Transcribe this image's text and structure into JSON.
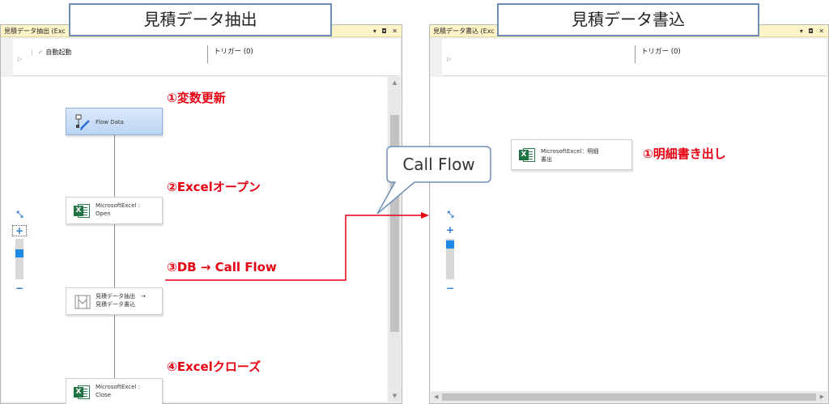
{
  "left_window": {
    "title": "見積データ抽出 (Exc",
    "controls": "▾ ◘ ✕",
    "autostart_label": "自動起動",
    "trigger_label": "トリガー (0)",
    "nodes": [
      {
        "label": "Flow Data"
      },
      {
        "label_line1": "MicrosoftExcel :",
        "label_line2": "Open"
      },
      {
        "label_line1": "見積データ抽出　→",
        "label_line2": "見積データ書込"
      },
      {
        "label_line1": "MicrosoftExcel :",
        "label_line2": "Close"
      }
    ]
  },
  "right_window": {
    "title": "見積データ書込 (Exc",
    "controls": "▾ ◘ ✕",
    "trigger_label": "トリガー (0)",
    "nodes": [
      {
        "label_line1": "MicrosoftExcel：明細",
        "label_line2": "書出"
      }
    ]
  },
  "overlay": {
    "title_left": "見積データ抽出",
    "title_right": "見積データ書込",
    "callout": "Call Flow",
    "annotations_left": [
      "①変数更新",
      "②Excelオープン",
      "③DB → Call Flow",
      "④Excelクローズ"
    ],
    "annotations_right": [
      "①明細書き出し"
    ]
  },
  "icons": {
    "zoom_fit": "fit-to-window-icon",
    "zoom_in": "zoom-in-icon",
    "zoom_out": "zoom-out-icon",
    "excel": "excel-icon",
    "flow_data": "flow-data-icon",
    "call_flow": "call-flow-icon"
  },
  "colors": {
    "annotation": "#e60012",
    "title_border": "#6f8eb4",
    "callout_border": "#6f8eb4",
    "selected_node": "#bcd4f3",
    "zoom_knob": "#1e88e5"
  }
}
